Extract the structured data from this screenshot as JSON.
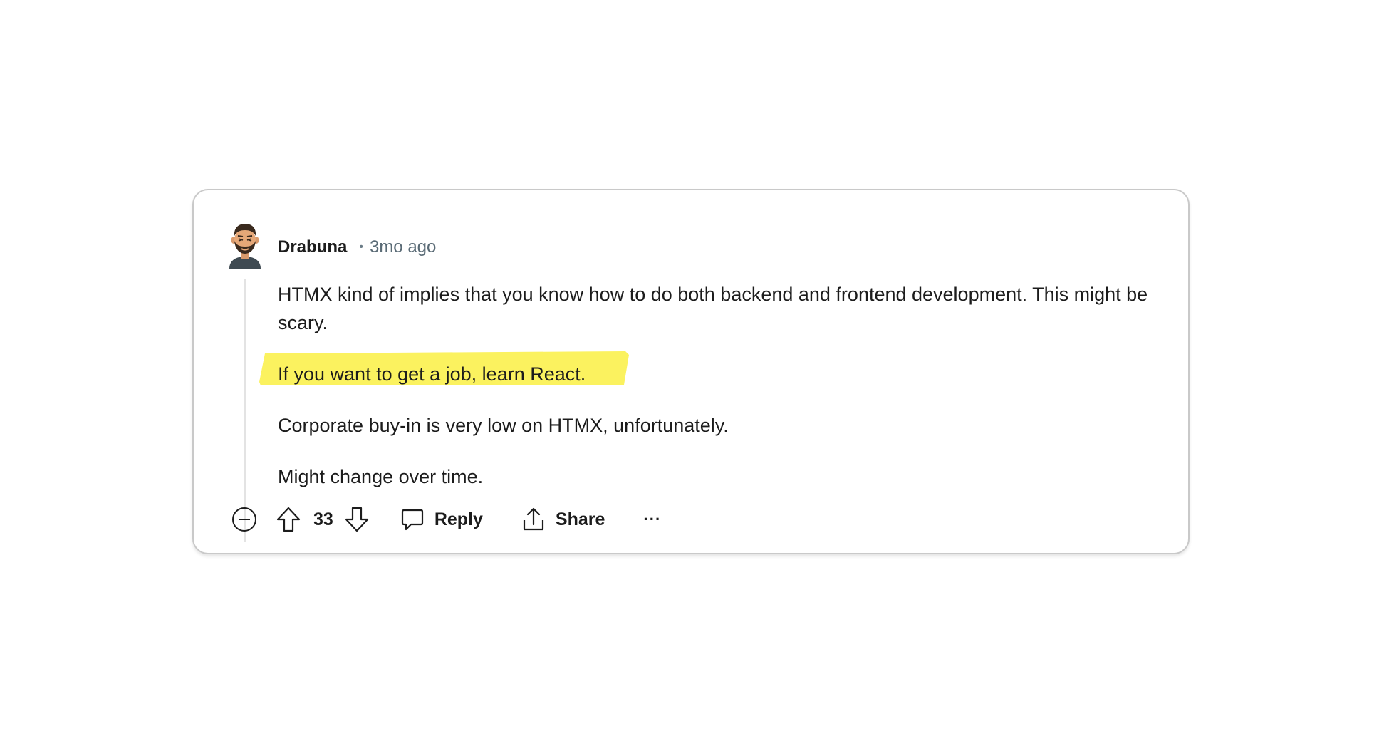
{
  "comment": {
    "author": "Drabuna",
    "separator": "•",
    "time": "3mo ago",
    "paragraphs": [
      "HTMX kind of implies that you know how to do both backend and frontend development. This might be scary.",
      "If you want to get a job, learn React.",
      "Corporate buy-in is very low on HTMX, unfortunately.",
      "Might change over time."
    ],
    "highlight_color": "#fbf25f",
    "avatar_icon": "bearded-man-avatar-icon"
  },
  "actions": {
    "collapse_icon": "minus-circle-icon",
    "upvote_icon": "arrow-up-icon",
    "vote_count": "33",
    "downvote_icon": "arrow-down-icon",
    "reply_label": "Reply",
    "reply_icon": "speech-bubble-icon",
    "share_label": "Share",
    "share_icon": "share-upload-icon",
    "more_label": "···",
    "more_icon": "ellipsis-icon"
  }
}
